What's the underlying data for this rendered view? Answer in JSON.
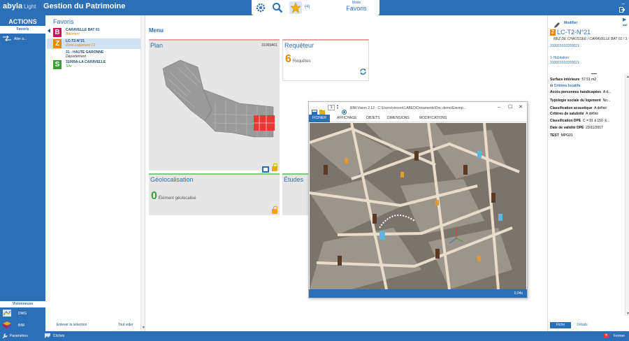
{
  "header": {
    "logo": "abyla",
    "edition": "Light",
    "title": "Gestion du Patrimoine",
    "favorites_count": "(4)",
    "mode_label": "Mode",
    "mode_value": "Favoris"
  },
  "left": {
    "actions_title": "ACTIONS",
    "favoris_tab": "Favoris",
    "aller_label": "Aller à...",
    "visionneuse_title": "Visionneuse",
    "dwg_label": "DWG",
    "bim_label": "BIM"
  },
  "favorites": {
    "title": "Favoris",
    "items": [
      {
        "badge": "B",
        "name": "CARAVELLE BAT 01",
        "sub": "Bâtiment",
        "badge_color": "#c2185b",
        "sub_color": "#e58a00"
      },
      {
        "badge": "Z",
        "name": "LC-T2-N°21",
        "sub": "Zone Logement T2",
        "badge_color": "#e58a00",
        "sub_color": "#e58a00"
      },
      {
        "badge": "",
        "name": "31 - HAUTE GARONNE",
        "sub": "Département",
        "badge_color": "",
        "sub_color": "#333333"
      },
      {
        "badge": "S",
        "name": "31069A-LA CARAVELLE",
        "sub": "Site",
        "badge_color": "#3aa335",
        "sub_color": "#3aa335"
      }
    ],
    "footer_left": "Enlever la sélection",
    "footer_right": "Tout vider"
  },
  "menu": {
    "title": "Menu",
    "plan": {
      "title": "Plan",
      "code": "31069A01"
    },
    "requeteur": {
      "title": "Requêteur",
      "count": "6",
      "label": "Requêtes"
    },
    "geo": {
      "title": "Géolocalisation",
      "count": "0",
      "label": "Élément géolocalisé"
    },
    "etudes": {
      "title": "Études"
    }
  },
  "bim": {
    "page": "1",
    "title": "BIM Vision 2.12 - C:\\Users\\vincent.LABED\\Documents\\Doc demo\\Exemp...",
    "menu": [
      "FICHIER",
      "AFFICHAGE",
      "OBJETS",
      "DIMENSIONS",
      "MODIFICATIONS"
    ],
    "status": "0.04s"
  },
  "detail": {
    "modifier": "Modifier",
    "badge": "Z",
    "title": "LC-T2-N°21",
    "path": "REZ DE CHAUSSEE / CARAVELLE BAT 01 / 310...",
    "code1": "310015010200021",
    "hab_label": "1-Habitation",
    "code2": "310015010200021",
    "surface_label": "Surface intérieure",
    "surface_value": "57.51 m2",
    "section": "Critères locatifs",
    "rows": [
      {
        "k": "Accès personnes handicapées",
        "v": "A d..."
      },
      {
        "k": "Typologie sociale du logement",
        "v": "No..."
      },
      {
        "k": "Classification acoustique",
        "v": "A définir"
      },
      {
        "k": "Critères de salubrité",
        "v": "A définir"
      },
      {
        "k": "Classification DPE",
        "v": "C = 91 à 150",
        "extra": "k..."
      },
      {
        "k": "Date de validité DPE",
        "v": "23/11/2017"
      },
      {
        "k": "TEST",
        "v": "MPG01"
      }
    ],
    "tab_fiche": "Fiche",
    "tab_detail": "Détails"
  },
  "footer": {
    "parametres": "Paramètres",
    "cliches": "Clichés",
    "fermer": "Fermer"
  },
  "colors": {
    "brand": "#2b6fb7",
    "accent": "#e58a00"
  }
}
